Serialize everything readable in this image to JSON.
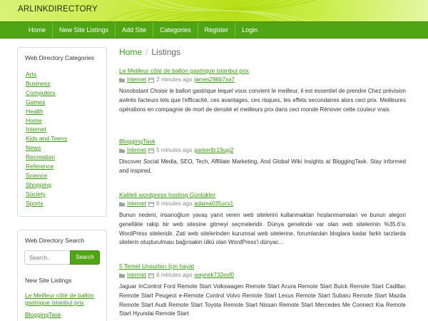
{
  "site": {
    "brand": "ARLINKDIRECTORY"
  },
  "nav": [
    "Home",
    "New Site Listings",
    "Add Site",
    "Categories",
    "Register",
    "Login"
  ],
  "sidebar": {
    "categories_title": "Web Directory Categories",
    "categories": [
      "Arts",
      "Business",
      "Computers",
      "Games",
      "Health",
      "Home",
      "Internet",
      "Kids and Teens",
      "News",
      "Recreation",
      "Reference",
      "Science",
      "Shopping",
      "Society",
      "Sports"
    ],
    "search_title": "Web Directory Search",
    "search_placeholder": "Search..",
    "search_button": "Search",
    "new_sites_title": "New Site Listings",
    "new_sites": [
      "Le Meilleur côté de ballon gastrique istanbul prix",
      "BloggingTask"
    ]
  },
  "breadcrumb": {
    "home": "Home",
    "current": "Listings"
  },
  "listings": [
    {
      "title": "Le Meilleur côté de ballon gastrique istanbul prix",
      "category": "Internet",
      "time": "2 minutes ago",
      "author": "james296b7xa7",
      "description": "Nonobstant Choisir le ballon gastrique lequel vous convient le meilleur, il est essentiel de prendre Chez prévision avérés facteurs tels que l'efficacité, ces avantages, ces risques, les effets secondaires alors ceci prix. Meilleures opérations en compagnie de mort de densité et meilleurs prix dans ceci monde Rénover cette couleur vrais"
    },
    {
      "title": "BloggingTask",
      "category": "Internet",
      "time": "5 minutes ago",
      "author": "parker8c19upj2",
      "description": "Discover Social Media, SEO, Tech, Affiliate Marketing, And Global Wiki Insights at BloggingTask. Stay informed and inspired."
    },
    {
      "title": "Kaliteli wordpress hosting Günlükler",
      "category": "Internet",
      "time": "6 minutes ago",
      "author": "adama035ucv1",
      "description": "Bunun nedeni, insanoğluın yavaş yanıt veren web sitelerini kullanmaktan hoşlanmamaları ve bunun alegori genellikle rakip bir web sitesine gitmeyi seçmeleridir. Dünya genelinde var olan web sitelerinin %35.6'sı WordPress siteleridir. Zati web sitelerinden kurumsal web sitelerine, forumlardan bloglara kadar farklı tarzlarda sitelerin oluşturulması bağırsakin ülkü olan WordPress'i dünyac..."
    },
    {
      "title": "5 Temel Unsurları İçin hayat",
      "category": "Internet",
      "time": "6 minutes ago",
      "author": "waynek732evf0",
      "description": "Jaguar InControl Ford Remote Start Volkswagen Remote Start Acura Remote Start Buick Remote Start Cadillac Remote Start Peugeot e-Remote Control Volvo Remote Start Lexus Remote Start Subaru Remote Start Mazda Remote Start Audi Remote Start Toyota Remote Start Nissan Remote Start Mercedes Me Connect Kia Remote Start Hyundai Remote Start"
    }
  ]
}
